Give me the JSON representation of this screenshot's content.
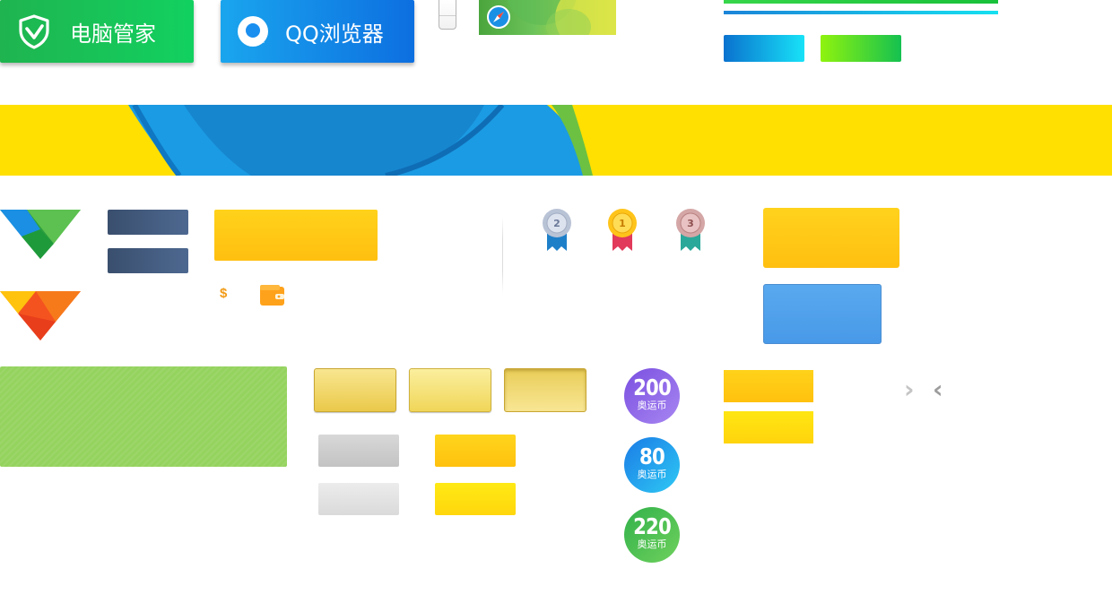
{
  "products": {
    "guard": {
      "label": "电脑管家",
      "icon": "shield-check-icon",
      "color": "#1fb44f"
    },
    "browser": {
      "label": "QQ浏览器",
      "icon": "qq-browser-logo-icon",
      "color": "#0d6fe0"
    }
  },
  "coins": [
    {
      "amount": "200",
      "currency": "奥运币",
      "color": "#8a63e8"
    },
    {
      "amount": "80",
      "currency": "奥运币",
      "color": "#1fa0ee"
    },
    {
      "amount": "220",
      "currency": "奥运币",
      "color": "#45bd4f"
    }
  ],
  "medals": [
    {
      "rank": "2",
      "type": "silver",
      "ribbon": "#1e7fc9"
    },
    {
      "rank": "1",
      "type": "gold",
      "ribbon": "#e23a5b"
    },
    {
      "rank": "3",
      "type": "bronze",
      "ribbon": "#2aa89a"
    }
  ],
  "misc": {
    "dollar_symbol": "$",
    "arrow_next": "›",
    "arrow_prev": "‹"
  },
  "colors": {
    "banner_yellow": "#ffe000",
    "accent_green": "#1fb44f",
    "accent_blue": "#1a7be6",
    "accent_yellow": "#ffc10e"
  }
}
